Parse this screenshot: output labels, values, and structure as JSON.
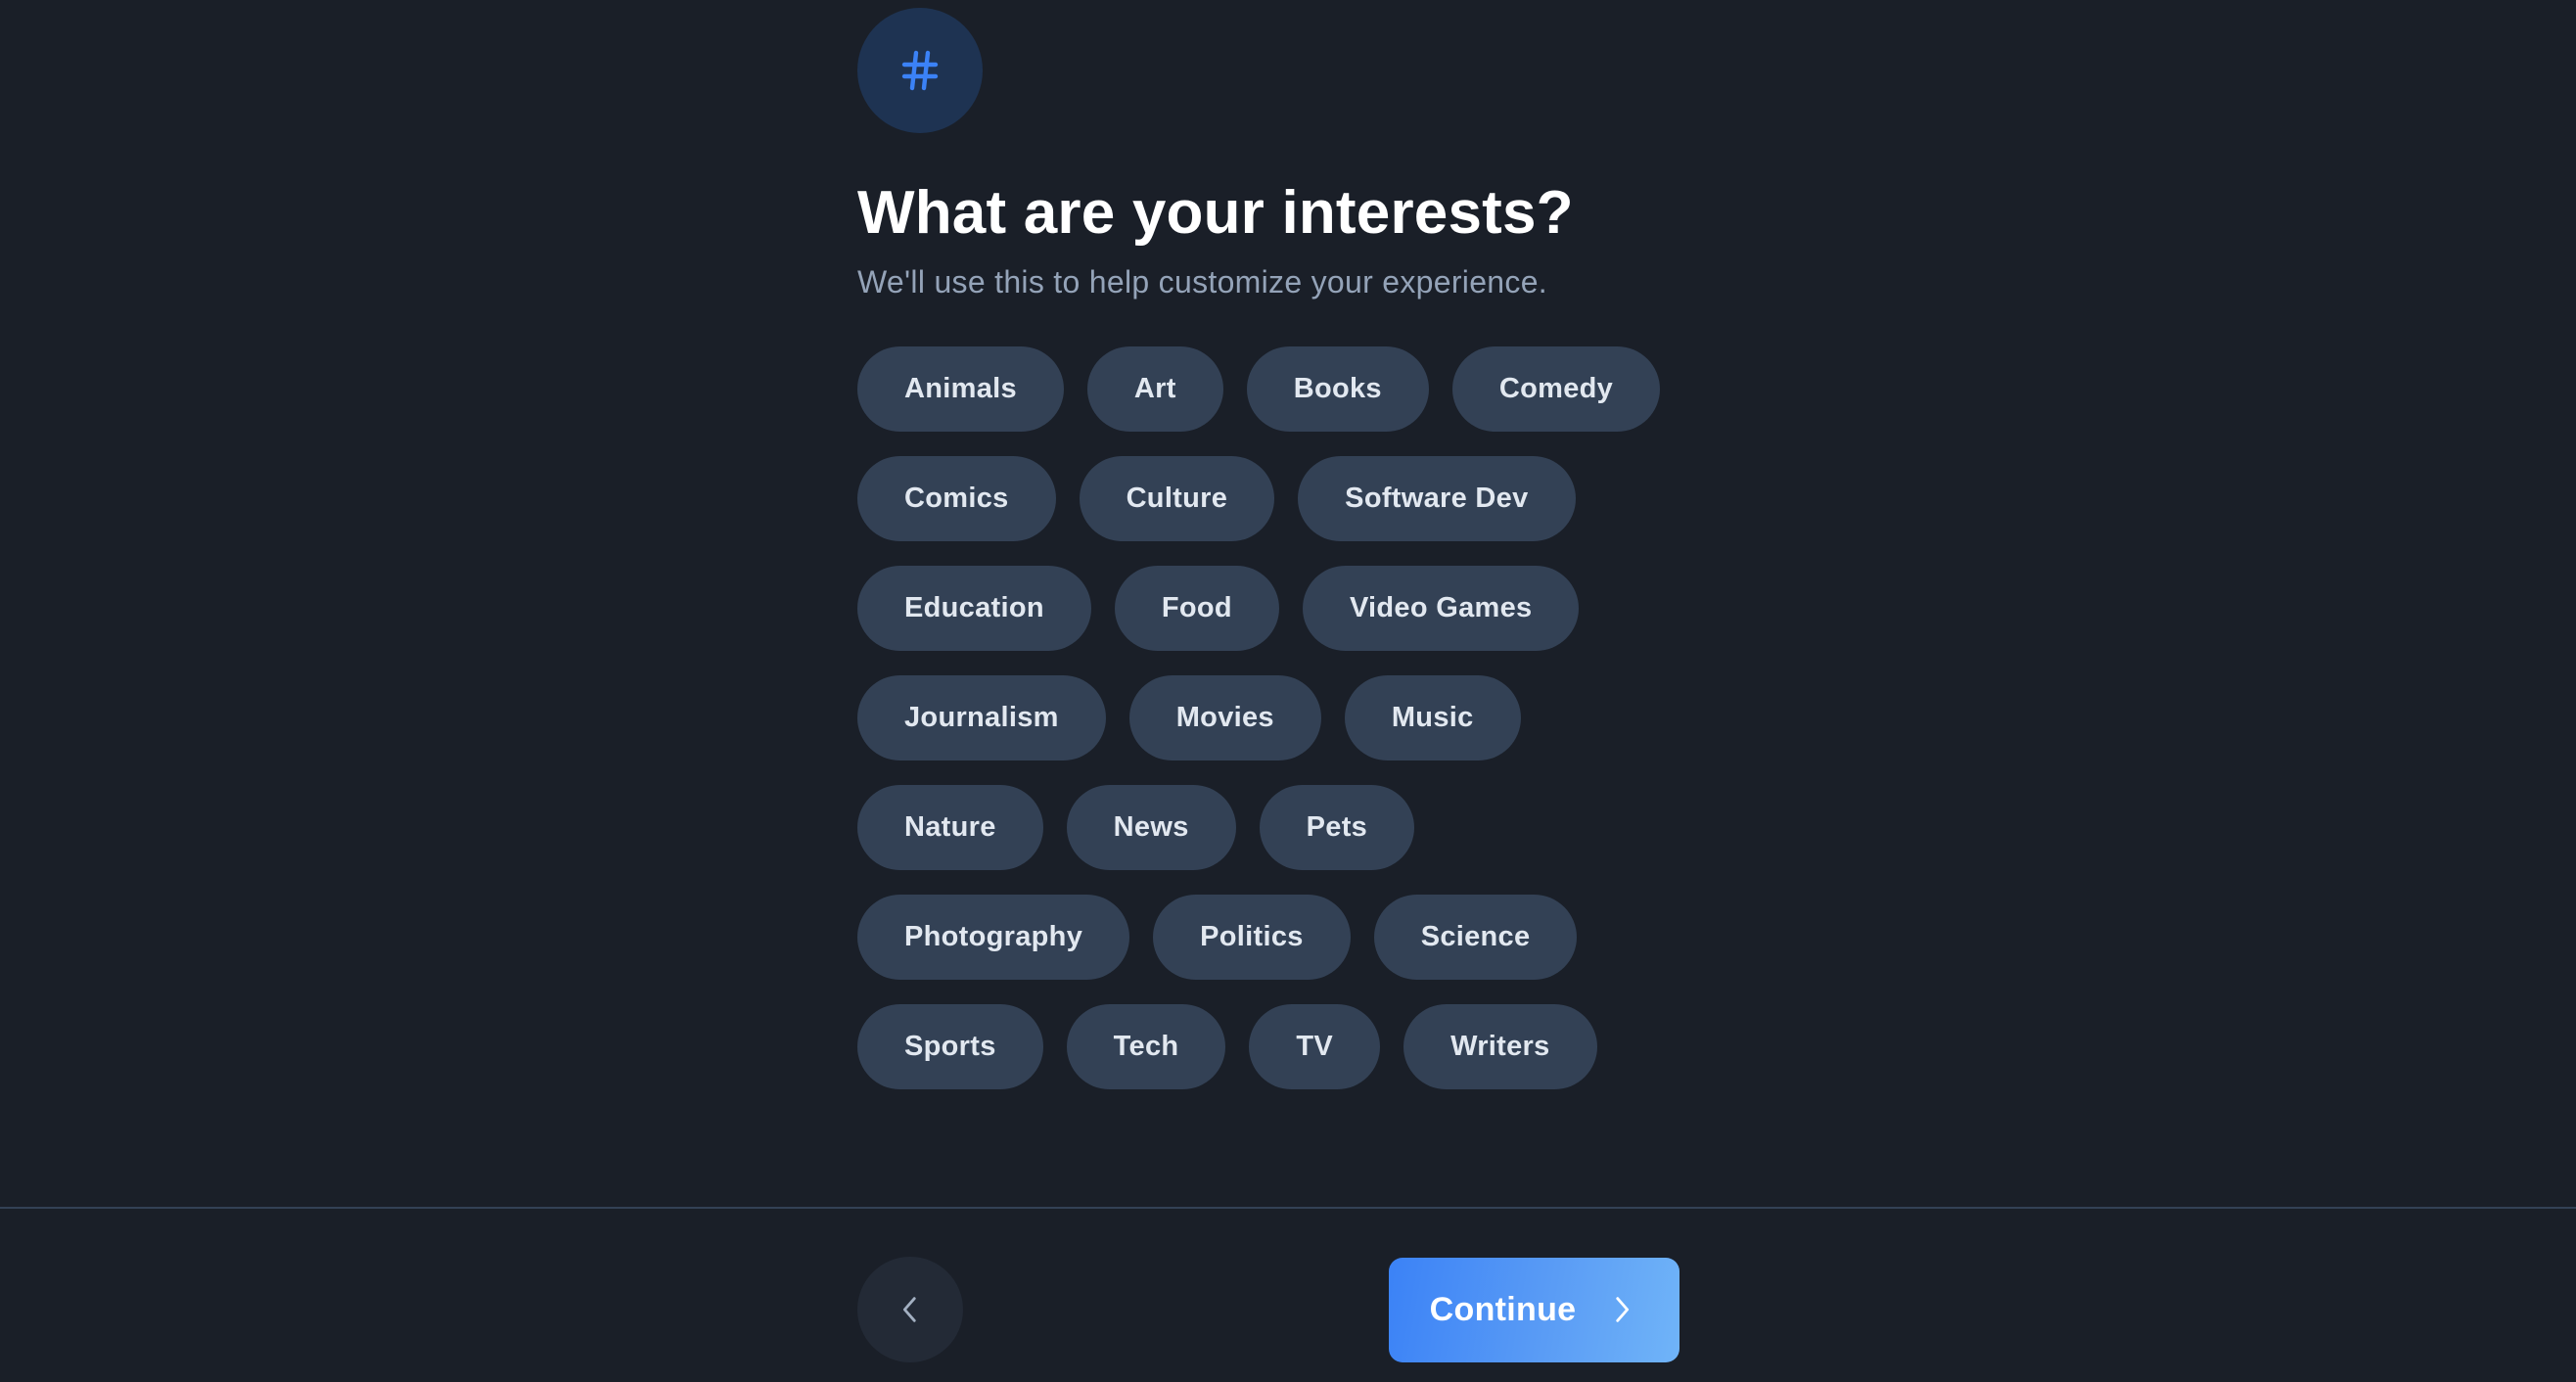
{
  "header": {
    "icon": "hash-icon",
    "title": "What are your interests?",
    "subtitle": "We'll use this to help customize your experience."
  },
  "interests": {
    "rows": [
      [
        "Animals",
        "Art",
        "Books",
        "Comedy"
      ],
      [
        "Comics",
        "Culture",
        "Software Dev"
      ],
      [
        "Education",
        "Food",
        "Video Games"
      ],
      [
        "Journalism",
        "Movies",
        "Music"
      ],
      [
        "Nature",
        "News",
        "Pets"
      ],
      [
        "Photography",
        "Politics",
        "Science"
      ],
      [
        "Sports",
        "Tech",
        "TV",
        "Writers"
      ]
    ]
  },
  "footer": {
    "back_icon": "chevron-left-icon",
    "continue_label": "Continue",
    "continue_icon": "chevron-right-icon"
  },
  "colors": {
    "background": "#1a1f28",
    "chip_background": "#334155",
    "chip_text": "#e2e8f0",
    "accent": "#3b82f6",
    "accent_light": "#70b4f8",
    "icon_circle": "#1e3352",
    "subtitle": "#94a3b8",
    "divider": "#334155"
  }
}
